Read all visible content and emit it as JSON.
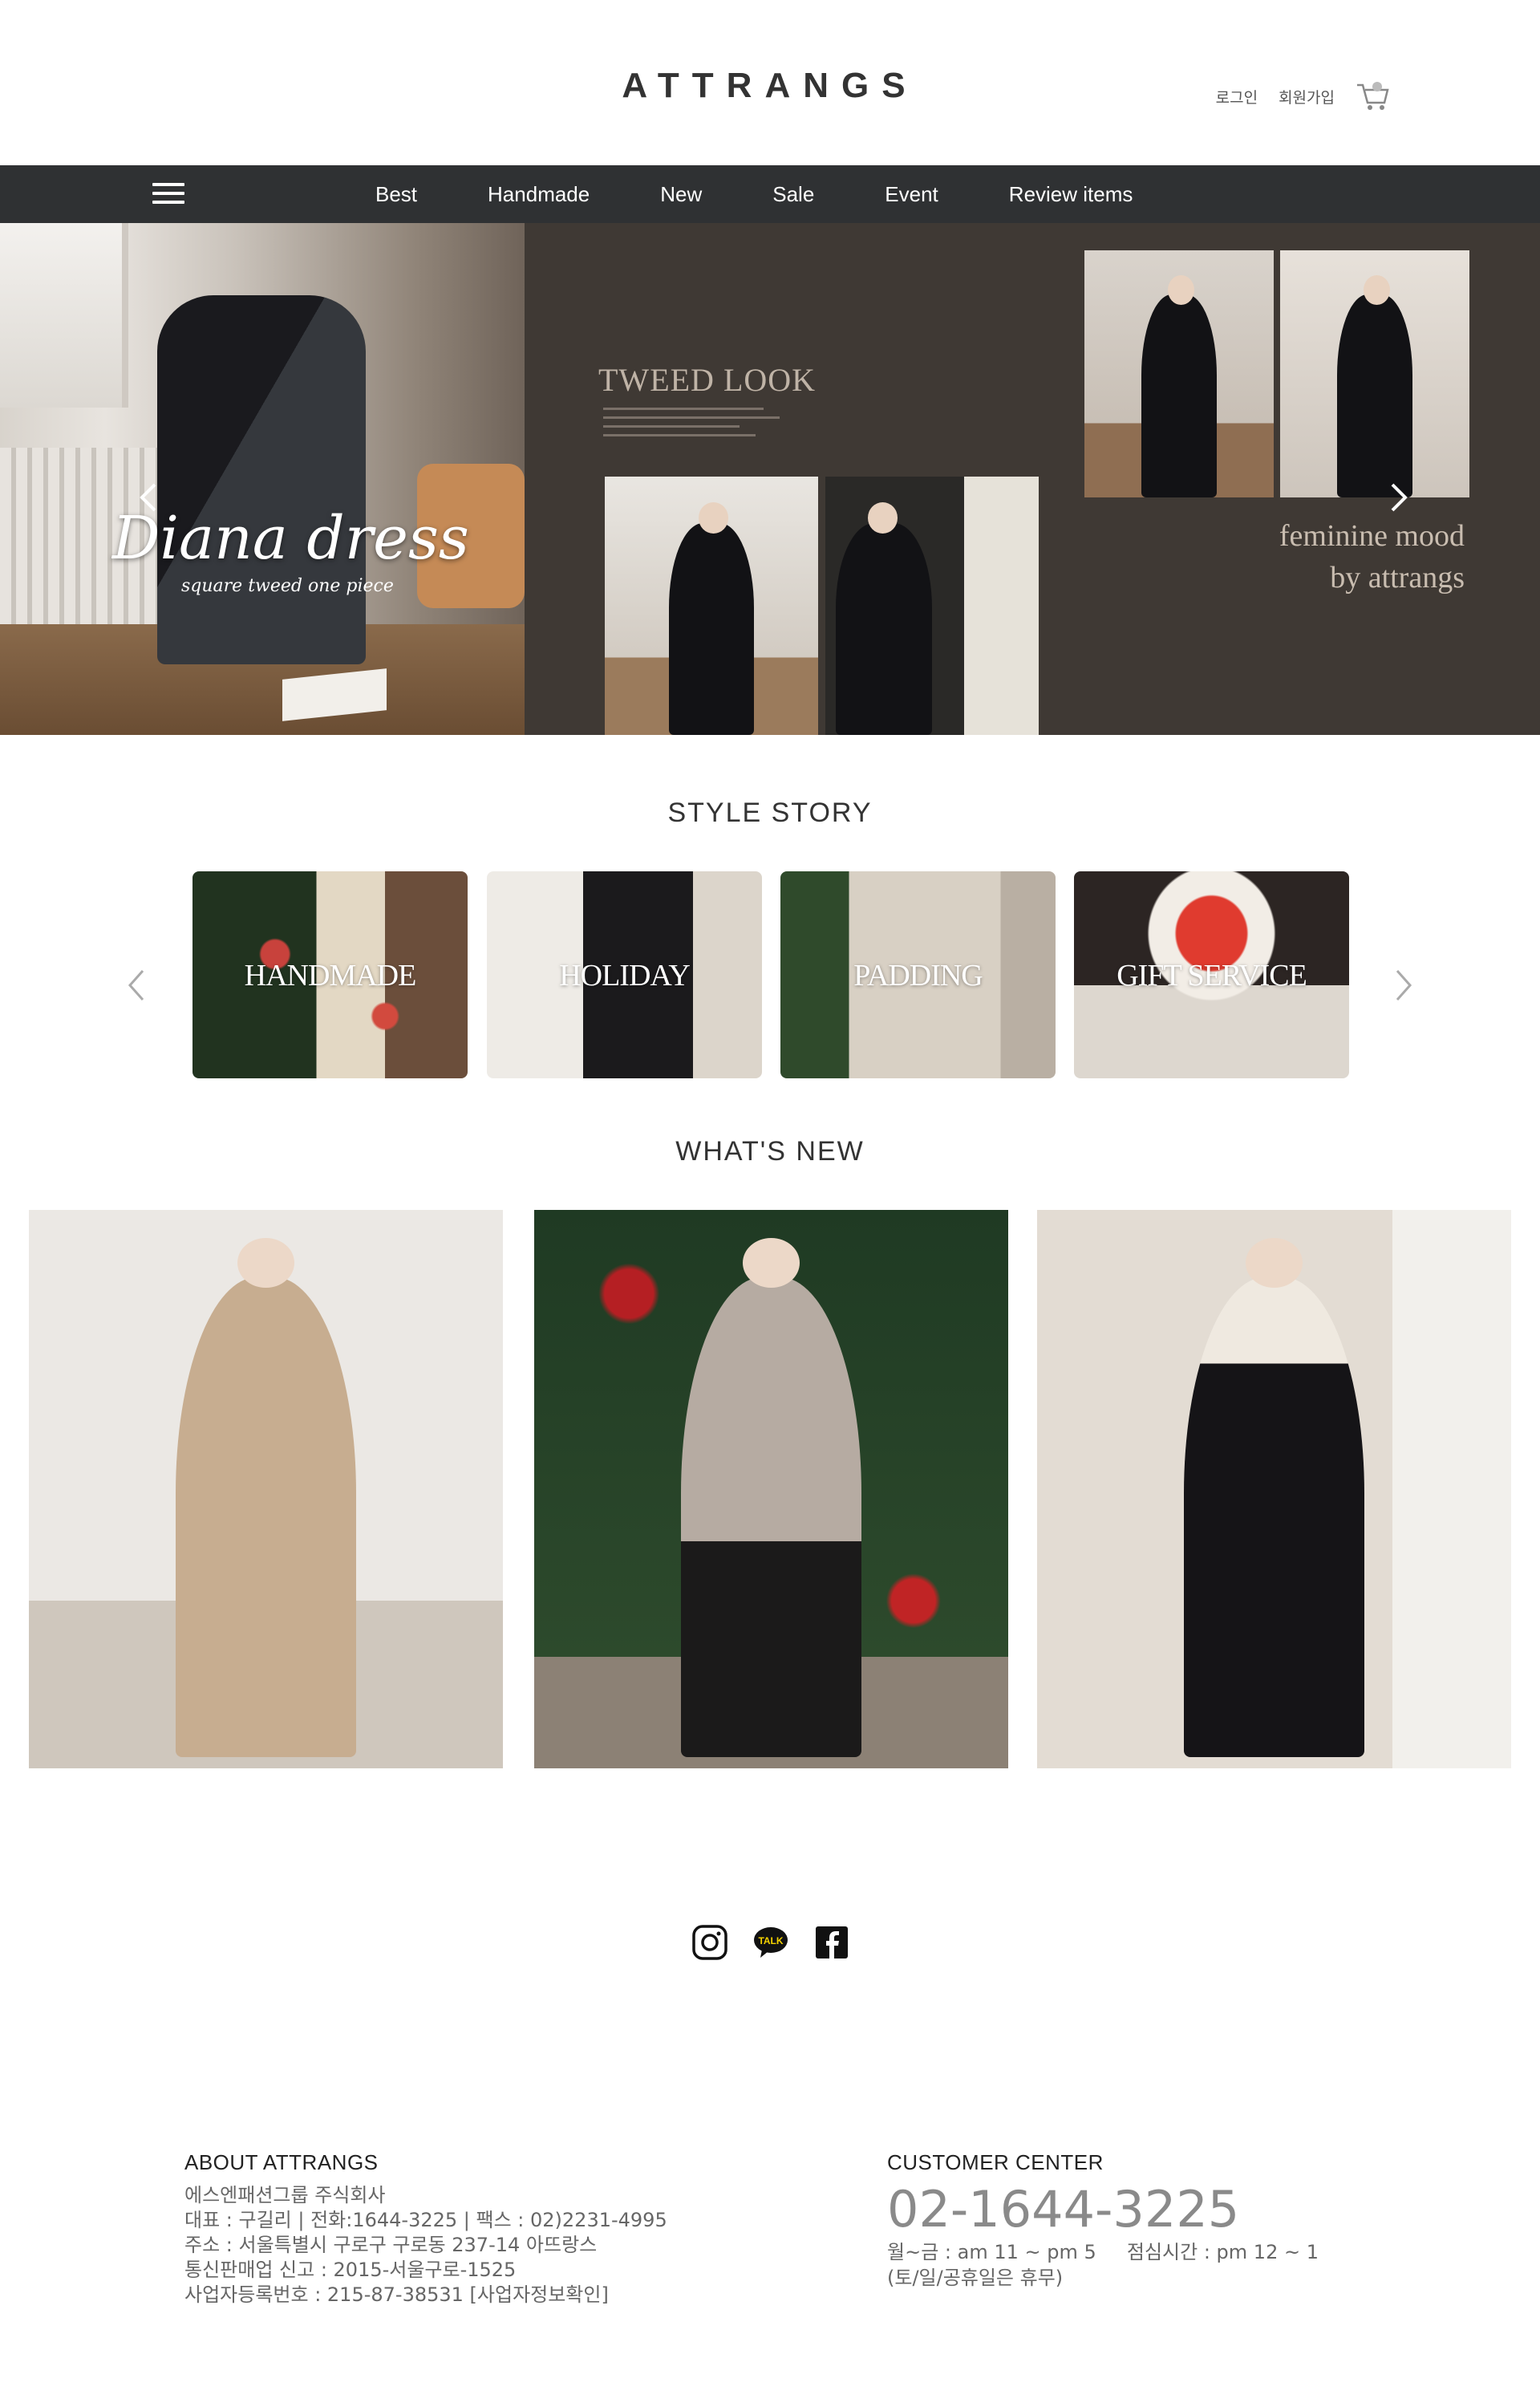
{
  "header": {
    "logo": "ATTRANGS",
    "login": "로그인",
    "signup": "회원가입",
    "cart_icon": "cart-icon"
  },
  "nav": {
    "menu_icon": "hamburger-menu-icon",
    "items": [
      "Best",
      "Handmade",
      "New",
      "Sale",
      "Event",
      "Review items"
    ]
  },
  "hero": {
    "title": "Diana dress",
    "subtitle": "square tweed one piece",
    "tweed_title": "TWEED LOOK",
    "feminine_line1": "feminine mood",
    "feminine_line2": "by attrangs",
    "prev_icon": "chevron-left-icon",
    "next_icon": "chevron-right-icon"
  },
  "style_story": {
    "title": "STYLE STORY",
    "cards": [
      "HANDMADE",
      "HOLIDAY",
      "PADDING",
      "GIFT SERVICE"
    ]
  },
  "whats_new": {
    "title": "WHAT'S NEW"
  },
  "social": [
    "instagram-icon",
    "kakaotalk-icon",
    "facebook-icon"
  ],
  "social_talk_label": "TALK",
  "footer": {
    "about_title": "ABOUT ATTRANGS",
    "about_lines": [
      "에스엔패션그룹 주식회사",
      "대표 : 구길리 | 전화:1644-3225 | 팩스 : 02)2231-4995",
      "주소 : 서울특별시 구로구 구로동 237-14 아뜨랑스",
      "통신판매업 신고 : 2015-서울구로-1525",
      "사업자등록번호 : 215-87-38531 [사업자정보확인]"
    ],
    "cc_title": "CUSTOMER CENTER",
    "cc_phone": "02-1644-3225",
    "cc_hours_line1": "월~금 : am 11 ~ pm 5     점심시간 : pm 12 ~ 1",
    "cc_hours_line2": "(토/일/공휴일은 휴무)"
  }
}
